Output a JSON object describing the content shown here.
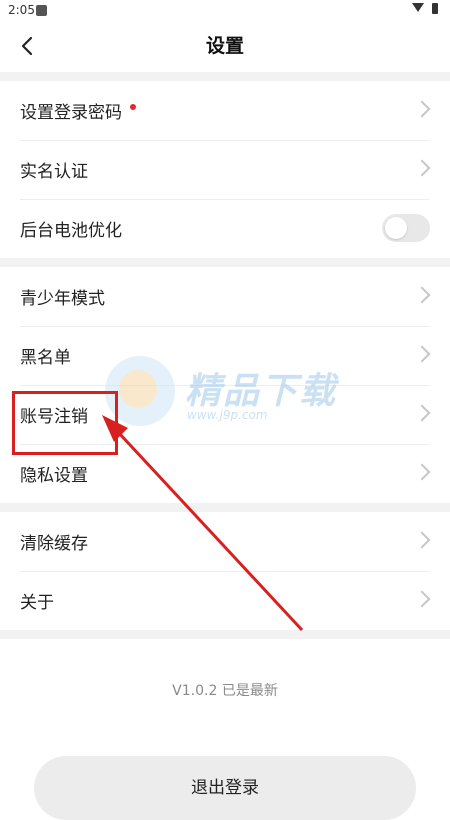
{
  "status_bar": {
    "time": "2:05"
  },
  "header": {
    "title": "设置"
  },
  "groups": [
    {
      "items": [
        {
          "label": "设置登录密码",
          "badge": "red-dot",
          "control": "chevron"
        },
        {
          "label": "实名认证",
          "control": "chevron"
        },
        {
          "label": "后台电池优化",
          "control": "toggle",
          "toggle_on": false
        }
      ]
    },
    {
      "items": [
        {
          "label": "青少年模式",
          "control": "chevron"
        },
        {
          "label": "黑名单",
          "control": "chevron"
        },
        {
          "label": "账号注销",
          "control": "chevron",
          "highlighted": true
        },
        {
          "label": "隐私设置",
          "control": "chevron"
        }
      ]
    },
    {
      "items": [
        {
          "label": "清除缓存",
          "control": "chevron"
        },
        {
          "label": "关于",
          "control": "chevron"
        }
      ]
    }
  ],
  "version_text": "V1.0.2 已是最新",
  "logout_label": "退出登录",
  "watermark": {
    "title": "精品下载",
    "url": "www.j9p.com"
  },
  "colors": {
    "accent_red": "#e8262d",
    "annotation_red": "#d92020",
    "separator": "#f2f2f2"
  }
}
